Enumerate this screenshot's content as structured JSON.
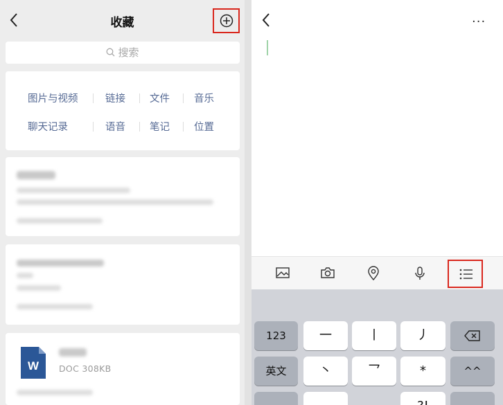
{
  "left": {
    "title": "收藏",
    "search_placeholder": "搜索",
    "categories": [
      "图片与视频",
      "链接",
      "文件",
      "音乐",
      "聊天记录",
      "语音",
      "笔记",
      "位置"
    ],
    "doc_item": {
      "icon_letter": "W",
      "meta": "DOC 308KB"
    }
  },
  "right": {
    "more_label": "···",
    "toolbar_icons": [
      "image-icon",
      "camera-icon",
      "location-icon",
      "microphone-icon",
      "list-icon"
    ]
  },
  "keyboard": {
    "row1": [
      "123",
      "一",
      "丨",
      "丿"
    ],
    "row2": [
      "英文",
      "丶",
      "乛",
      "*",
      "^^"
    ],
    "row3": [
      "",
      "",
      "?!",
      ""
    ]
  },
  "colors": {
    "accent_red": "#d9261c",
    "link_blue": "#576b95",
    "doc_blue": "#2b5797"
  }
}
